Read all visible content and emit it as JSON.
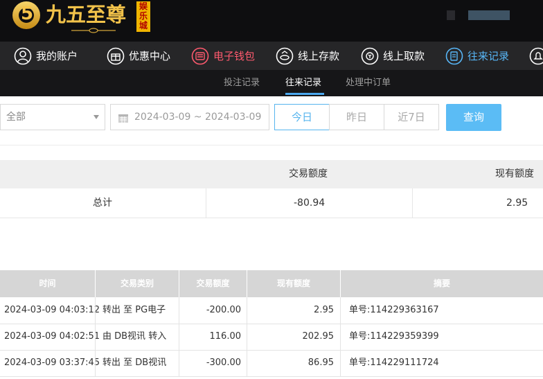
{
  "header": {
    "logo_char": "5",
    "logo_text": "九五至尊",
    "logo_badge": "娱乐城"
  },
  "nav": {
    "items": [
      {
        "label": "我的账户",
        "icon": "user-icon"
      },
      {
        "label": "优惠中心",
        "icon": "gift-icon"
      },
      {
        "label": "电子钱包",
        "icon": "wallet-icon",
        "state": "highlight",
        "color": "#ff5a6e"
      },
      {
        "label": "线上存款",
        "icon": "deposit-icon"
      },
      {
        "label": "线上取款",
        "icon": "withdraw-icon"
      },
      {
        "label": "往来记录",
        "icon": "records-icon",
        "state": "active",
        "color": "#58b7f8"
      },
      {
        "label": "",
        "icon": "bell-icon"
      }
    ]
  },
  "subnav": {
    "tabs": [
      "投注记录",
      "往来记录",
      "处理中订单"
    ],
    "active": "往来记录"
  },
  "filters": {
    "type_select": "全部",
    "date_range": "2024-03-09 ~ 2024-03-09",
    "quick_ranges": [
      "今日",
      "昨日",
      "近7日"
    ],
    "active_range": "今日",
    "query_label": "查询",
    "accent": "#56b4ee"
  },
  "summary": {
    "headers": [
      "",
      "交易额度",
      "现有额度"
    ],
    "row": {
      "label": "总计",
      "amount": "-80.94",
      "balance": "2.95"
    }
  },
  "details": {
    "columns": [
      "时间",
      "交易类别",
      "交易额度",
      "现有额度",
      "摘要"
    ],
    "rows": [
      [
        "2024-03-09 04:03:12",
        "转出 至 PG电子",
        "-200.00",
        "2.95",
        "单号:114229363167"
      ],
      [
        "2024-03-09 04:02:51",
        "由 DB视讯 转入",
        "116.00",
        "202.95",
        "单号:114229359399"
      ],
      [
        "2024-03-09 03:37:45",
        "转出 至 DB视讯",
        "-300.00",
        "86.95",
        "单号:114229111724"
      ]
    ]
  }
}
